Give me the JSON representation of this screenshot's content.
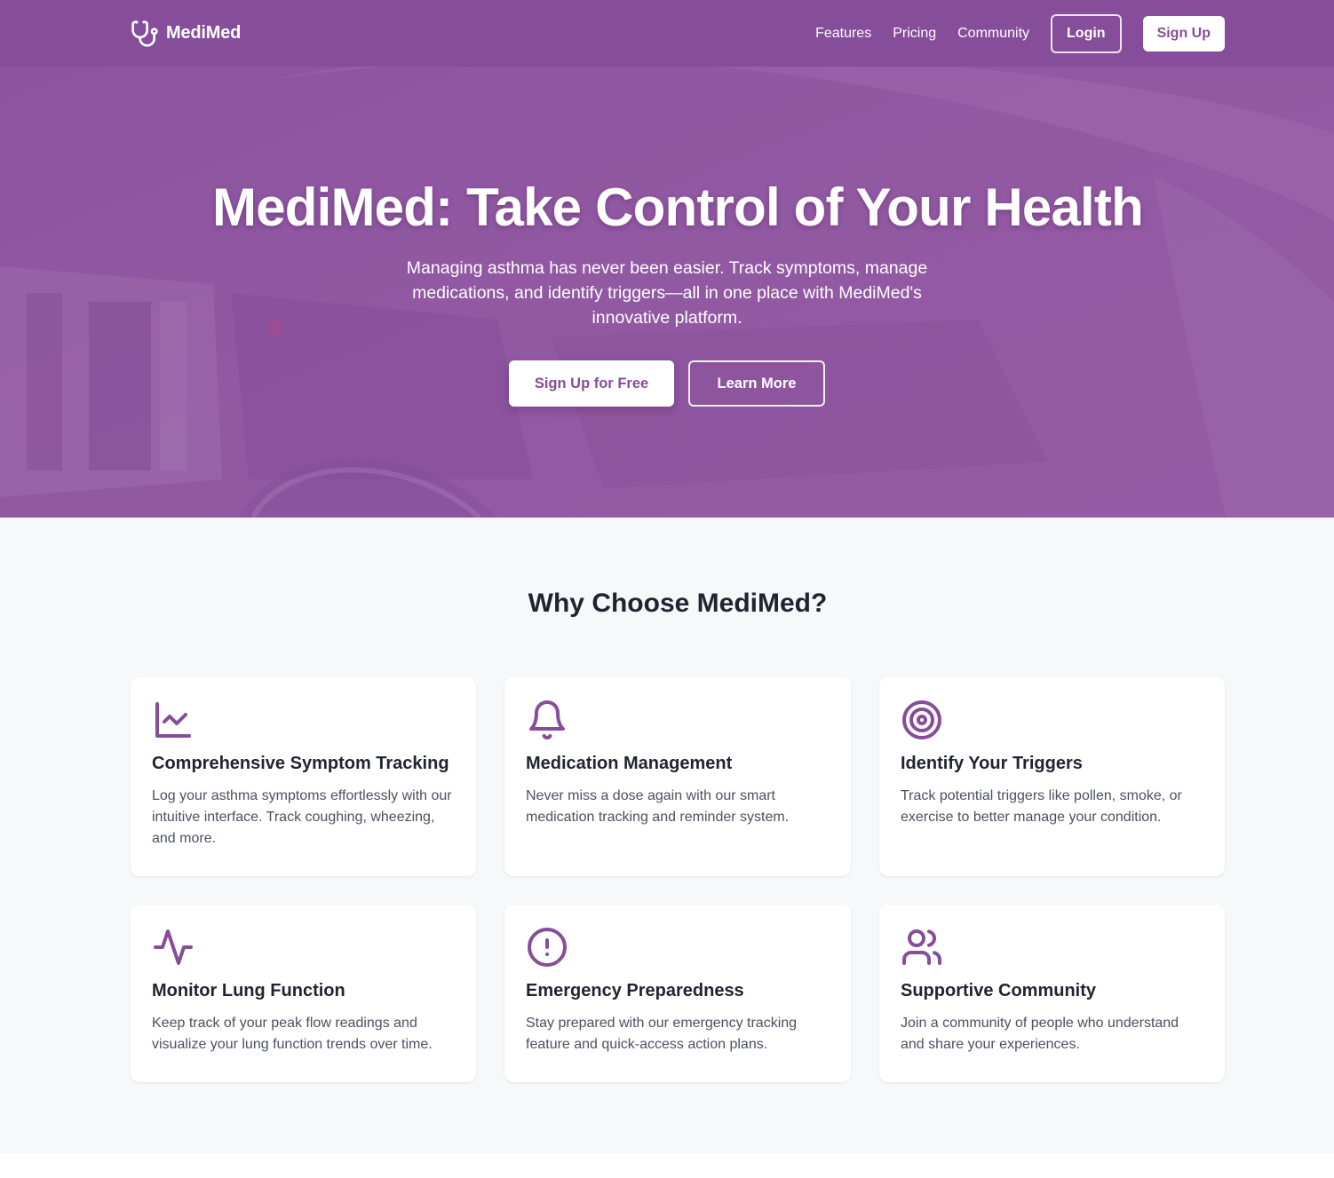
{
  "brand": {
    "name": "MediMed",
    "icon": "stethoscope-icon"
  },
  "nav": {
    "links": [
      "Features",
      "Pricing",
      "Community"
    ],
    "login_label": "Login",
    "signup_label": "Sign Up"
  },
  "hero": {
    "title": "MediMed: Take Control of Your Health",
    "subtitle": "Managing asthma has never been easier. Track symptoms, manage medications, and identify triggers—all in one place with MediMed's innovative platform.",
    "primary_cta": "Sign Up for Free",
    "secondary_cta": "Learn More"
  },
  "features": {
    "title": "Why Choose MediMed?",
    "items": [
      {
        "icon": "line-chart-icon",
        "title": "Comprehensive Symptom Tracking",
        "text": "Log your asthma symptoms effortlessly with our intuitive interface. Track coughing, wheezing, and more."
      },
      {
        "icon": "bell-icon",
        "title": "Medication Management",
        "text": "Never miss a dose again with our smart medication tracking and reminder system."
      },
      {
        "icon": "target-icon",
        "title": "Identify Your Triggers",
        "text": "Track potential triggers like pollen, smoke, or exercise to better manage your condition."
      },
      {
        "icon": "activity-icon",
        "title": "Monitor Lung Function",
        "text": "Keep track of your peak flow readings and visualize your lung function trends over time."
      },
      {
        "icon": "alert-circle-icon",
        "title": "Emergency Preparedness",
        "text": "Stay prepared with our emergency tracking feature and quick-access action plans."
      },
      {
        "icon": "users-icon",
        "title": "Supportive Community",
        "text": "Join a community of people who understand and share your experiences."
      }
    ]
  },
  "colors": {
    "brand_purple": "#864d9a",
    "page_bg": "#f7f8fa",
    "card_bg": "#ffffff",
    "heading": "#1f2430",
    "body_text": "#4a5160"
  }
}
